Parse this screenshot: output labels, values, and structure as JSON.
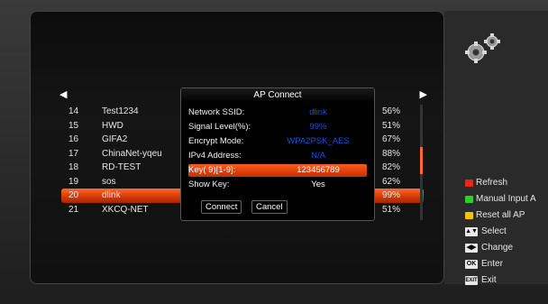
{
  "dialog": {
    "title": "AP Connect",
    "fields": [
      {
        "label": "Network SSID:",
        "value": "dlink"
      },
      {
        "label": "Signal Level(%):",
        "value": "99%"
      },
      {
        "label": "Encrypt Mode:",
        "value": "WPA2PSK_AES"
      },
      {
        "label": "IPv4 Address:",
        "value": "N/A"
      },
      {
        "label": "Key( 9)[1-9]:",
        "value": "123456789"
      },
      {
        "label": "Show Key:",
        "value": "Yes"
      }
    ],
    "connect_label": "Connect",
    "cancel_label": "Cancel"
  },
  "ap_list": [
    {
      "num": "14",
      "name": "Test1234",
      "signal": "56%"
    },
    {
      "num": "15",
      "name": "HWD",
      "signal": "51%"
    },
    {
      "num": "16",
      "name": "GIFA2",
      "signal": "67%"
    },
    {
      "num": "17",
      "name": "ChinaNet-yqeu",
      "signal": "88%"
    },
    {
      "num": "18",
      "name": "RD-TEST",
      "signal": "82%"
    },
    {
      "num": "19",
      "name": "sos",
      "signal": "62%"
    },
    {
      "num": "20",
      "name": "dlink",
      "signal": "99%"
    },
    {
      "num": "21",
      "name": "XKCQ-NET",
      "signal": "51%"
    }
  ],
  "selected_index": 6,
  "nav": {
    "left_arrow": "◀",
    "right_arrow": "▶"
  },
  "legend": {
    "refresh": "Refresh",
    "manual_input": "Manual Input A",
    "reset_all": "Reset all AP",
    "select": "Select",
    "change": "Change",
    "enter_key": "OK",
    "enter": "Enter",
    "exit_key": "EXIT",
    "exit": "Exit"
  },
  "colors": {
    "accent": "#ff5a1e",
    "red_key": "#e02a1a",
    "green_key": "#2ecc2e",
    "yellow_key": "#f2c300",
    "value_blue": "#1c4fd8"
  }
}
